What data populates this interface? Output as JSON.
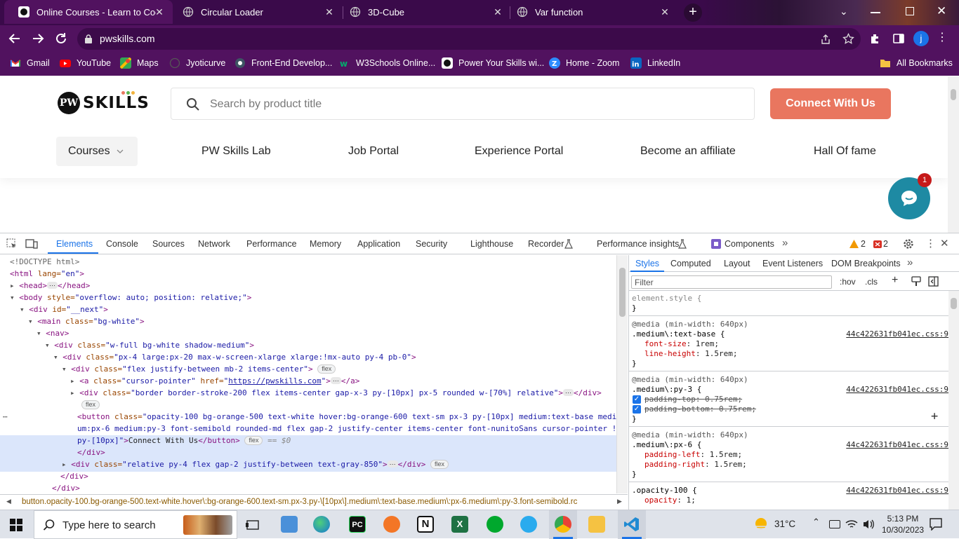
{
  "browser": {
    "tabs": [
      {
        "title": "Online Courses - Learn to Code",
        "active": true
      },
      {
        "title": "Circular Loader",
        "active": false
      },
      {
        "title": "3D-Cube",
        "active": false
      },
      {
        "title": "Var function",
        "active": false
      }
    ],
    "url": "pwskills.com",
    "profile_initial": "j",
    "bookmarks": [
      "Gmail",
      "YouTube",
      "Maps",
      "Jyoticurve",
      "Front-End Develop...",
      "W3Schools Online...",
      "Power Your Skills wi...",
      "Home - Zoom",
      "LinkedIn"
    ],
    "all_bookmarks": "All Bookmarks"
  },
  "site": {
    "logo_mark": "PW",
    "logo_text": "SKILLS",
    "search_placeholder": "Search by product title",
    "connect_button": "Connect With Us",
    "nav": [
      "Courses",
      "PW Skills Lab",
      "Job Portal",
      "Experience Portal",
      "Become an affiliate",
      "Hall Of fame"
    ],
    "chat_badge": "1"
  },
  "devtools": {
    "tabs": [
      "Elements",
      "Console",
      "Sources",
      "Network",
      "Performance",
      "Memory",
      "Application",
      "Security",
      "Lighthouse",
      "Recorder",
      "Performance insights",
      "Components"
    ],
    "warnings": "2",
    "errors": "2",
    "dom": {
      "doctype": "<!DOCTYPE html>",
      "html_tag": "<html",
      "lang_attr": " lang=",
      "lang_val": "\"en\"",
      "gt": ">",
      "head_open": "<head>",
      "head_close": "</head>",
      "body_open": "<body",
      "style_attr": " style=",
      "body_style": "\"overflow: auto; position: relative;\"",
      "div_open": "<div",
      "id_attr": " id=",
      "next_id": "\"__next\"",
      "main_open": "<main",
      "class_attr": " class=",
      "main_class": "\"bg-white\"",
      "nav_open": "<nav>",
      "div1_class": "\"w-full bg-white shadow-medium\"",
      "div2_class": "\"px-4 large:px-20 max-w-screen-xlarge xlarge:!mx-auto py-4 pb-0\"",
      "div3_class": "\"flex justify-between mb-2 items-center\"",
      "flex": "flex",
      "a_open": "<a",
      "a_class": "\"cursor-pointer\"",
      "href_attr": " href=",
      "q": "\"",
      "a_href": "https://pwskills.com",
      "a_close": "</a>",
      "div4_class": "\"border border-stroke-200 flex items-center gap-x-3 py-[10px] px-5 rounded w-[70%] relative\"",
      "div_close": "</div>",
      "button_open": "<button",
      "button_class_1": "\"opacity-100 bg-orange-500 text-white hover:bg-orange-600 text-sm px-3 py-[10px] medium:text-base medi",
      "button_class_2": "um:px-6 medium:py-3 font-semibold rounded-md flex gap-2 justify-center items-center font-nunitoSans cursor-pointer !",
      "button_class_3": "py-[10px]\"",
      "button_text": "Connect With Us",
      "button_close": "</button>",
      "eq_dollar": "== $0",
      "div5_class": "\"relative py-4 flex gap-2 justify-between text-gray-850\""
    },
    "breadcrumb": "button.opacity-100.bg-orange-500.text-white.hover\\:bg-orange-600.text-sm.px-3.py-\\[10px\\].medium\\:text-base.medium\\:px-6.medium\\:py-3.font-semibold.rc",
    "styles": {
      "tabs": [
        "Styles",
        "Computed",
        "Layout",
        "Event Listeners",
        "DOM Breakpoints"
      ],
      "filter_placeholder": "Filter",
      "hov": ":hov",
      "cls": ".cls",
      "element_style": "element.style {",
      "close_brace": "}",
      "media": "@media (min-width: 640px)",
      "source": "44c422631fb041ec.css:9",
      "rule1_sel": ".medium\\:text-base {",
      "rule1_p1": "font-size",
      "rule1_v1": "1rem;",
      "rule1_p2": "line-height",
      "rule1_v2": "1.5rem;",
      "rule2_sel": ".medium\\:py-3 {",
      "rule2_l1": "padding-top: 0.75rem;",
      "rule2_l2": "padding-bottom: 0.75rem;",
      "rule3_sel": ".medium\\:px-6 {",
      "rule3_p1": "padding-left",
      "rule3_v1": "1.5rem;",
      "rule3_p2": "padding-right",
      "rule3_v2": "1.5rem;",
      "rule4_sel": ".opacity-100 {",
      "rule4_p1": "opacity",
      "rule4_v1": "1;"
    }
  },
  "taskbar": {
    "search_placeholder": "Type here to search",
    "temperature": "31°C",
    "time": "5:13 PM",
    "date": "10/30/2023"
  },
  "colors": {
    "chrome_frame": "#51125f",
    "connect_button": "#e9765f",
    "devtools_accent": "#1a73e8",
    "chat_bubble": "#1e8aa3"
  }
}
